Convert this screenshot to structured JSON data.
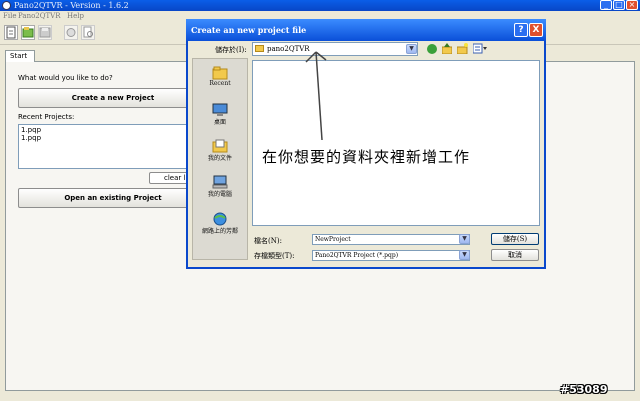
{
  "app": {
    "title": "Pano2QTVR - Version - 1.6.2"
  },
  "menu": {
    "items": [
      "File",
      "Pano2QTVR",
      "Help"
    ]
  },
  "toolbar": {
    "icons": [
      "new-icon",
      "open-icon",
      "save-icon",
      "preview-icon",
      "view-icon"
    ]
  },
  "tabs": {
    "start": "Start"
  },
  "start": {
    "prompt": "What would you like to do?",
    "create_label": "Create a new Project",
    "recent_label": "Recent Projects:",
    "recent_items": [
      "1.pqp",
      "1.pqp"
    ],
    "clear_label": "clear list",
    "open_label": "Open an existing Project"
  },
  "dialog": {
    "title": "Create an new project file",
    "lookin_label": "儲存於(I):",
    "lookin_value": "pano2QTVR",
    "places": [
      {
        "label": "Recent",
        "icon": "recent-folder-icon"
      },
      {
        "label": "桌面",
        "icon": "desktop-icon"
      },
      {
        "label": "我的文件",
        "icon": "my-documents-icon"
      },
      {
        "label": "我的電腦",
        "icon": "my-computer-icon"
      },
      {
        "label": "網路上的芳鄰",
        "icon": "network-icon"
      }
    ],
    "annotation": "在你想要的資料夾裡新增工作",
    "filename_label": "檔名(N):",
    "filename_value": "NewProject",
    "filetype_label": "存檔類型(T):",
    "filetype_value": "Pano2QTVR Project (*.pqp)",
    "save_label": "儲存(S)",
    "cancel_label": "取消",
    "help_label": "?",
    "close_label": "X"
  },
  "watermark": "#53089",
  "colors": {
    "titlebar": "#0a4fd8",
    "close": "#e0502d",
    "dialog_border": "#0a48cc"
  }
}
